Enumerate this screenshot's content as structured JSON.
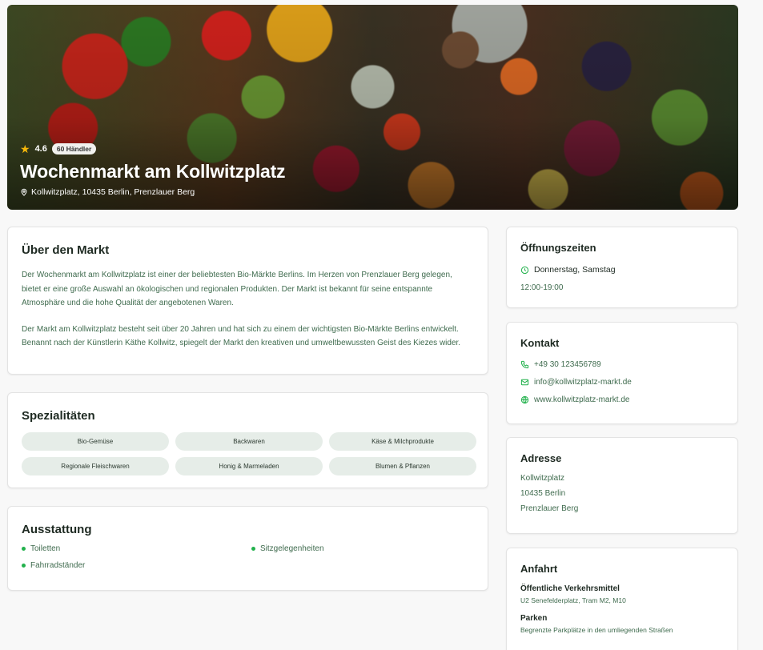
{
  "hero": {
    "rating": "4.6",
    "badge": "60 Händler",
    "title": "Wochenmarkt am Kollwitzplatz",
    "location": "Kollwitzplatz, 10435 Berlin, Prenzlauer Berg"
  },
  "about": {
    "heading": "Über den Markt",
    "paragraphs": [
      "Der Wochenmarkt am Kollwitzplatz ist einer der beliebtesten Bio-Märkte Berlins. Im Herzen von Prenzlauer Berg gelegen, bietet er eine große Auswahl an ökologischen und regionalen Produkten. Der Markt ist bekannt für seine entspannte Atmosphäre und die hohe Qualität der angebotenen Waren.",
      "Der Markt am Kollwitzplatz besteht seit über 20 Jahren und hat sich zu einem der wichtigsten Bio-Märkte Berlins entwickelt. Benannt nach der Künstlerin Käthe Kollwitz, spiegelt der Markt den kreativen und umweltbewussten Geist des Kiezes wider."
    ]
  },
  "specialties": {
    "heading": "Spezialitäten",
    "items": [
      "Bio-Gemüse",
      "Backwaren",
      "Käse & Milchprodukte",
      "Regionale Fleischwaren",
      "Honig & Marmeladen",
      "Blumen & Pflanzen"
    ]
  },
  "amenities": {
    "heading": "Ausstattung",
    "items": [
      "Toiletten",
      "Sitzgelegenheiten",
      "Fahrradständer"
    ]
  },
  "hours": {
    "heading": "Öffnungszeiten",
    "days": "Donnerstag, Samstag",
    "time": "12:00-19:00"
  },
  "contact": {
    "heading": "Kontakt",
    "phone": "+49 30 123456789",
    "email": "info@kollwitzplatz-markt.de",
    "website": "www.kollwitzplatz-markt.de"
  },
  "address": {
    "heading": "Adresse",
    "lines": [
      "Kollwitzplatz",
      "10435 Berlin",
      "Prenzlauer Berg"
    ]
  },
  "directions": {
    "heading": "Anfahrt",
    "transit_label": "Öffentliche Verkehrsmittel",
    "transit_value": "U2 Senefelderplatz, Tram M2, M10",
    "parking_label": "Parken",
    "parking_value": "Begrenzte Parkplätze in den umliegenden Straßen"
  },
  "colors": {
    "accent": "#22b14c",
    "text_muted": "#3f6b4e",
    "chip_bg": "#e6ede8",
    "star": "#f5b70a"
  },
  "icons": {
    "rating": "star-icon",
    "location": "map-pin-icon",
    "hours": "clock-icon",
    "phone": "phone-icon",
    "email": "mail-icon",
    "website": "globe-icon"
  }
}
